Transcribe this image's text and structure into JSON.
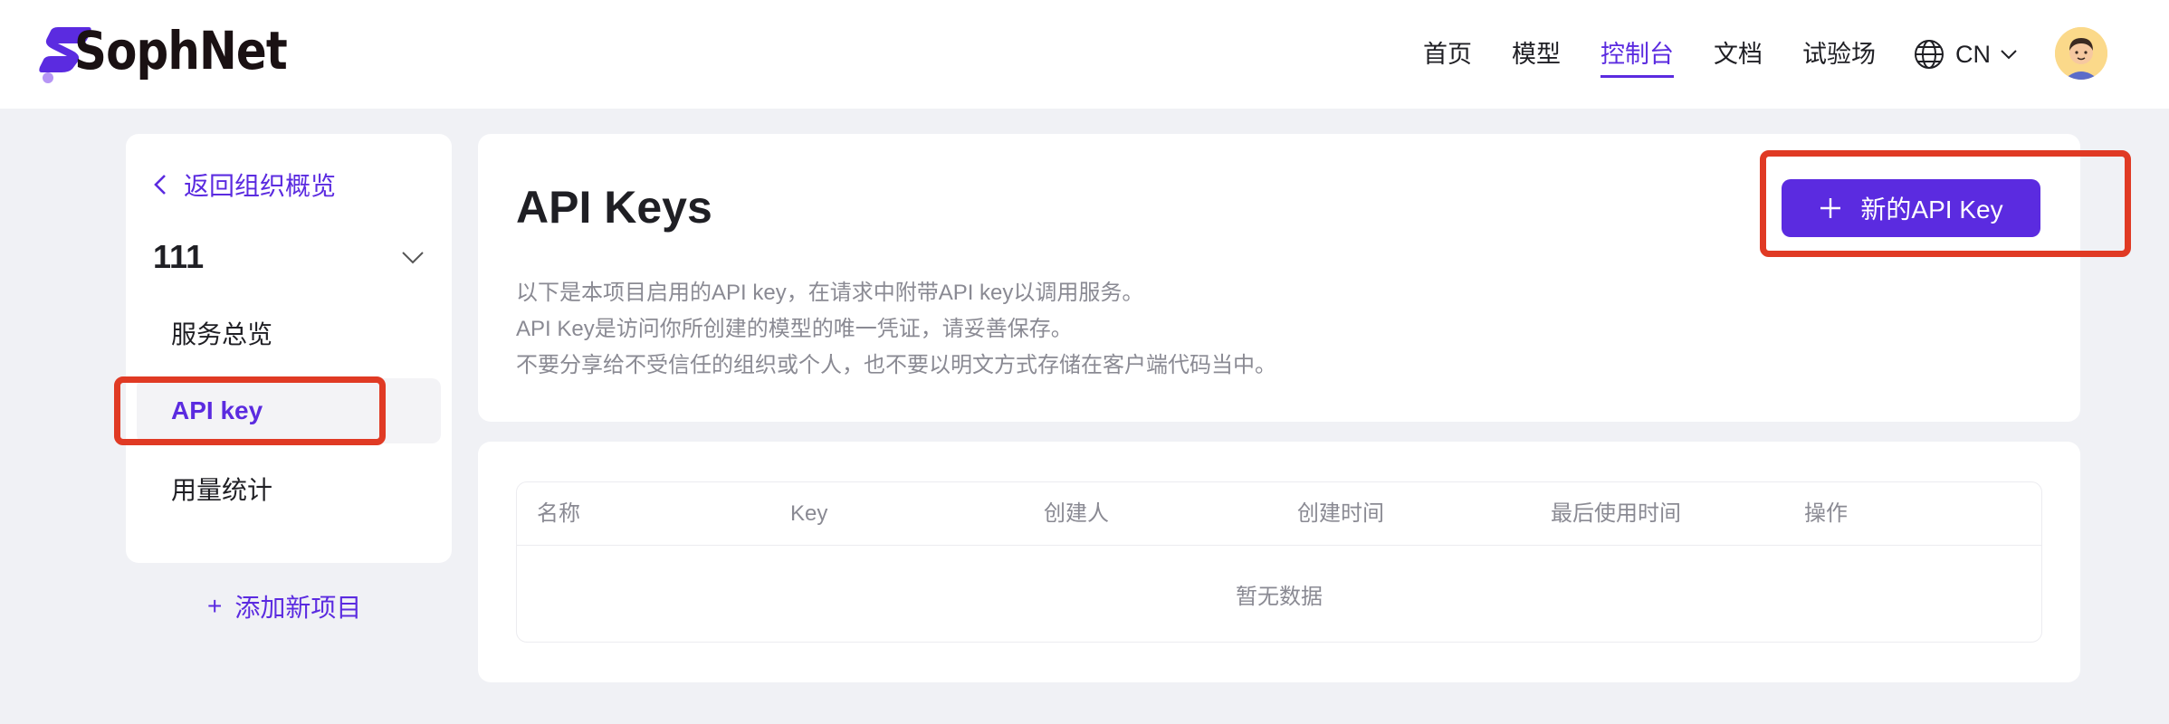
{
  "header": {
    "brand": "SophNet",
    "nav": [
      {
        "label": "首页",
        "active": false
      },
      {
        "label": "模型",
        "active": false
      },
      {
        "label": "控制台",
        "active": true
      },
      {
        "label": "文档",
        "active": false
      },
      {
        "label": "试验场",
        "active": false
      }
    ],
    "language": "CN",
    "icons": {
      "language": "globe-icon",
      "dropdown": "chevron-down-icon",
      "avatar": "user-avatar"
    }
  },
  "sidebar": {
    "back_label": "返回组织概览",
    "project_name": "111",
    "items": [
      {
        "label": "服务总览",
        "active": false
      },
      {
        "label": "API key",
        "active": true
      },
      {
        "label": "用量统计",
        "active": false
      }
    ],
    "add_project_label": "添加新项目"
  },
  "main": {
    "title": "API Keys",
    "description": [
      "以下是本项目启用的API key，在请求中附带API key以调用服务。",
      "API Key是访问你所创建的模型的唯一凭证，请妥善保存。",
      "不要分享给不受信任的组织或个人，也不要以明文方式存储在客户端代码当中。"
    ],
    "new_key_label": "新的API Key",
    "table": {
      "columns": [
        "名称",
        "Key",
        "创建人",
        "创建时间",
        "最后使用时间",
        "操作"
      ],
      "rows": [],
      "empty_text": "暂无数据"
    }
  },
  "colors": {
    "accent": "#5b2be0",
    "highlight": "#e03a24",
    "background": "#f0f1f5"
  }
}
